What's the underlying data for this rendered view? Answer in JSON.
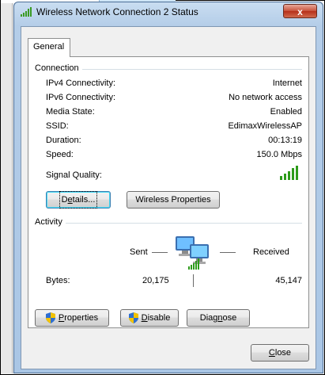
{
  "window": {
    "title": "Wireless Network Connection 2 Status",
    "close_glyph": "x"
  },
  "tabs": [
    {
      "label": "General"
    }
  ],
  "connection": {
    "group_label": "Connection",
    "rows": [
      {
        "label": "IPv4 Connectivity:",
        "value": "Internet"
      },
      {
        "label": "IPv6 Connectivity:",
        "value": "No network access"
      },
      {
        "label": "Media State:",
        "value": "Enabled"
      },
      {
        "label": "SSID:",
        "value": "EdimaxWirelessAP"
      },
      {
        "label": "Duration:",
        "value": "00:13:19"
      },
      {
        "label": "Speed:",
        "value": "150.0 Mbps"
      }
    ],
    "signal_quality_label": "Signal Quality:",
    "signal_bars": 5,
    "details_button": {
      "pre": "D",
      "u": "e",
      "post": "tails..."
    },
    "wireless_properties_button": "Wireless Properties"
  },
  "activity": {
    "group_label": "Activity",
    "sent_label": "Sent",
    "received_label": "Received",
    "bytes_label": "Bytes:",
    "bytes_sent": "20,175",
    "bytes_received": "45,147"
  },
  "buttons": {
    "properties": {
      "u": "P",
      "post": "roperties"
    },
    "disable": {
      "u": "D",
      "post": "isable"
    },
    "diagnose": {
      "pre": "Diag",
      "u": "n",
      "post": "ose"
    },
    "close": {
      "u": "C",
      "post": "lose"
    }
  },
  "icons": {
    "title": "signal-bars-icon",
    "network": "network-computers-icon",
    "shield": "uac-shield-icon"
  },
  "colors": {
    "signal_green": "#2d9b1a",
    "close_red": "#c7503a",
    "title_bar": "#c9ddf1"
  }
}
